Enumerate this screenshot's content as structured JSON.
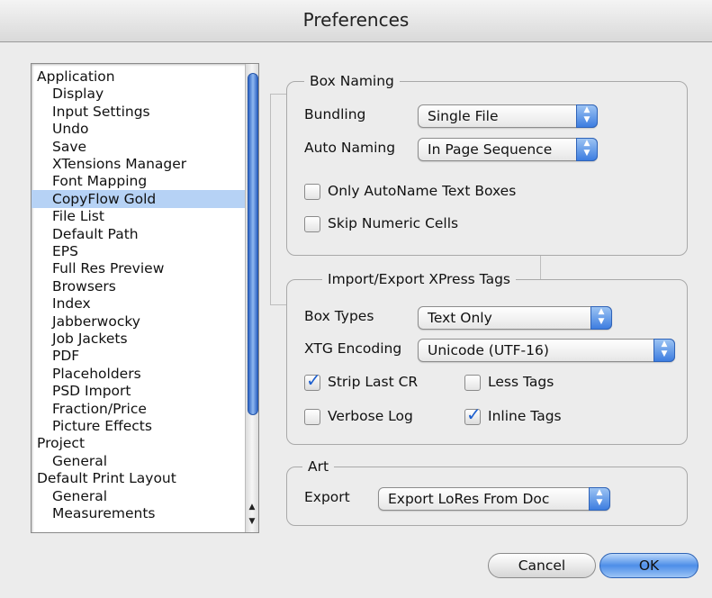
{
  "window": {
    "title": "Preferences"
  },
  "categories": [
    {
      "label": "Application",
      "level": 0,
      "selected": false
    },
    {
      "label": "Display",
      "level": 1,
      "selected": false
    },
    {
      "label": "Input Settings",
      "level": 1,
      "selected": false
    },
    {
      "label": "Undo",
      "level": 1,
      "selected": false
    },
    {
      "label": "Save",
      "level": 1,
      "selected": false
    },
    {
      "label": "XTensions Manager",
      "level": 1,
      "selected": false
    },
    {
      "label": "Font Mapping",
      "level": 1,
      "selected": false
    },
    {
      "label": "CopyFlow Gold",
      "level": 1,
      "selected": true
    },
    {
      "label": "File List",
      "level": 1,
      "selected": false
    },
    {
      "label": "Default Path",
      "level": 1,
      "selected": false
    },
    {
      "label": "EPS",
      "level": 1,
      "selected": false
    },
    {
      "label": "Full Res Preview",
      "level": 1,
      "selected": false
    },
    {
      "label": "Browsers",
      "level": 1,
      "selected": false
    },
    {
      "label": "Index",
      "level": 1,
      "selected": false
    },
    {
      "label": "Jabberwocky",
      "level": 1,
      "selected": false
    },
    {
      "label": "Job Jackets",
      "level": 1,
      "selected": false
    },
    {
      "label": "PDF",
      "level": 1,
      "selected": false
    },
    {
      "label": "Placeholders",
      "level": 1,
      "selected": false
    },
    {
      "label": "PSD Import",
      "level": 1,
      "selected": false
    },
    {
      "label": "Fraction/Price",
      "level": 1,
      "selected": false
    },
    {
      "label": "Picture Effects",
      "level": 1,
      "selected": false
    },
    {
      "label": "Project",
      "level": 0,
      "selected": false
    },
    {
      "label": "General",
      "level": 1,
      "selected": false
    },
    {
      "label": "Default Print Layout",
      "level": 0,
      "selected": false
    },
    {
      "label": "General",
      "level": 1,
      "selected": false
    },
    {
      "label": "Measurements",
      "level": 1,
      "selected": false
    }
  ],
  "box_naming": {
    "legend": "Box Naming",
    "bundling_label": "Bundling",
    "bundling_value": "Single File",
    "auto_naming_label": "Auto Naming",
    "auto_naming_value": "In Page Sequence",
    "only_autoname_label": "Only AutoName Text Boxes",
    "only_autoname_checked": false,
    "skip_numeric_label": "Skip Numeric Cells",
    "skip_numeric_checked": false
  },
  "import_export": {
    "legend": "Import/Export XPress Tags",
    "box_types_label": "Box Types",
    "box_types_value": "Text Only",
    "xtg_encoding_label": "XTG Encoding",
    "xtg_encoding_value": "Unicode (UTF-16)",
    "strip_last_cr_label": "Strip Last CR",
    "strip_last_cr_checked": true,
    "less_tags_label": "Less Tags",
    "less_tags_checked": false,
    "verbose_log_label": "Verbose Log",
    "verbose_log_checked": false,
    "inline_tags_label": "Inline Tags",
    "inline_tags_checked": true
  },
  "art": {
    "legend": "Art",
    "export_label": "Export",
    "export_value": "Export LoRes From Doc"
  },
  "buttons": {
    "cancel": "Cancel",
    "ok": "OK"
  }
}
